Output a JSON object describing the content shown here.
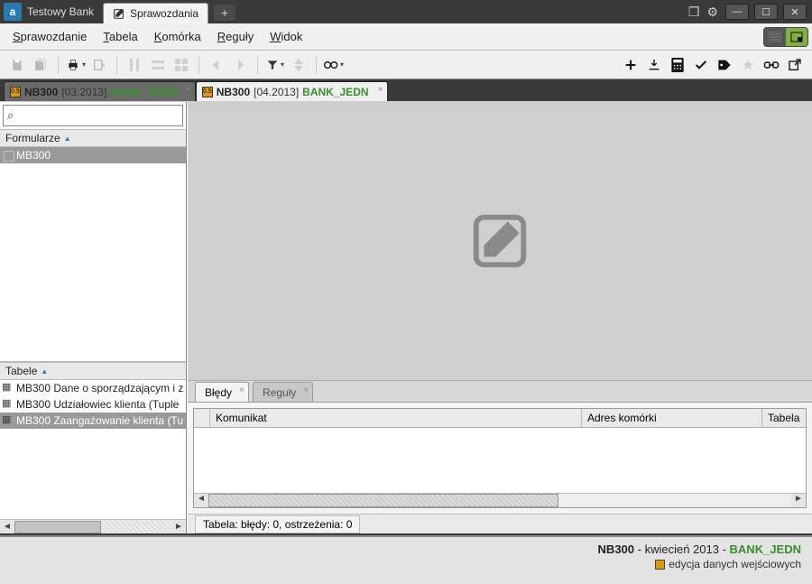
{
  "app": {
    "icon_letter": "a",
    "title": "Testowy Bank"
  },
  "title_tabs": {
    "active": {
      "label": "Sprawozdania"
    }
  },
  "window_controls": {
    "restore": "❐",
    "gear": "⚙",
    "min": "—",
    "max": "☐",
    "close": "✕"
  },
  "menu": [
    "Sprawozdanie",
    "Tabela",
    "Komórka",
    "Reguły",
    "Widok"
  ],
  "doc_tabs": [
    {
      "name": "NB300",
      "date": "[03.2013]",
      "unit": "BANK_JEDN",
      "active": false
    },
    {
      "name": "NB300",
      "date": "[04.2013]",
      "unit": "BANK_JEDN",
      "active": true
    }
  ],
  "left": {
    "search_icon": "⌕",
    "forms_header": "Formularze",
    "forms": [
      "MB300"
    ],
    "tables_header": "Tabele",
    "tables": [
      "MB300 Dane o sporządzającym i z",
      "MB300 Udziałowiec klienta (Tuple",
      "MB300 Zaangażowanie klienta (Tu"
    ]
  },
  "bottom_tabs": [
    {
      "label": "Błędy",
      "active": true
    },
    {
      "label": "Reguły",
      "active": false
    }
  ],
  "grid_columns": [
    "",
    "Komunikat",
    "Adres komórki",
    "Tabela"
  ],
  "status_mini": "Tabela: błędy: 0, ostrzeżenia: 0",
  "footer": {
    "name": "NB300",
    "sep": " - ",
    "period": "kwiecień 2013",
    "unit": "BANK_JEDN",
    "mode": "edycja danych wejściowych"
  },
  "icons": {
    "doc_badge": "0.5",
    "plus": "＋",
    "download": "⤓",
    "calc": "▦",
    "check": "✔",
    "tag": "◗",
    "star": "★",
    "link": "⮂",
    "export": "⤴",
    "save": "💾",
    "saveall": "💾",
    "print": "🖶",
    "chevL": "❮",
    "chevR": "❯",
    "funnel": "▼",
    "sort": "◆",
    "binoc": "👁"
  }
}
